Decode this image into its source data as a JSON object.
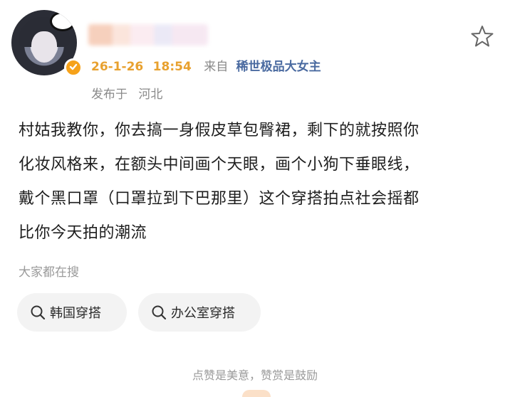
{
  "post": {
    "author": {
      "avatar_alt": "avatar",
      "verified_badge": "verified-badge-orange"
    },
    "date": "26-1-26",
    "time": "18:54",
    "from_label": "来自",
    "source": "稀世极品大女主",
    "location_label": "发布于",
    "location": "河北",
    "text_lines": [
      "村姑我教你，你去搞一身假皮草包臀裙，剩下的就按照你",
      "化妆风格来，在额头中间画个天眼，画个小狗下垂眼线，",
      "戴个黑口罩（口罩拉到下巴那里）这个穿搭拍点社会摇都",
      "比你今天拍的潮流"
    ]
  },
  "search": {
    "heading": "大家都在搜",
    "chips": [
      {
        "label": "韩国穿搭",
        "icon": "search-icon"
      },
      {
        "label": "办公室穿搭",
        "icon": "search-icon"
      }
    ]
  },
  "footer": {
    "tip": "点赞是美意，赞赏是鼓励"
  },
  "colors": {
    "accent": "#e8a12f",
    "source_link": "#4a6aa0",
    "muted": "#8a8a8a",
    "chip_bg": "#f3f3f3"
  }
}
